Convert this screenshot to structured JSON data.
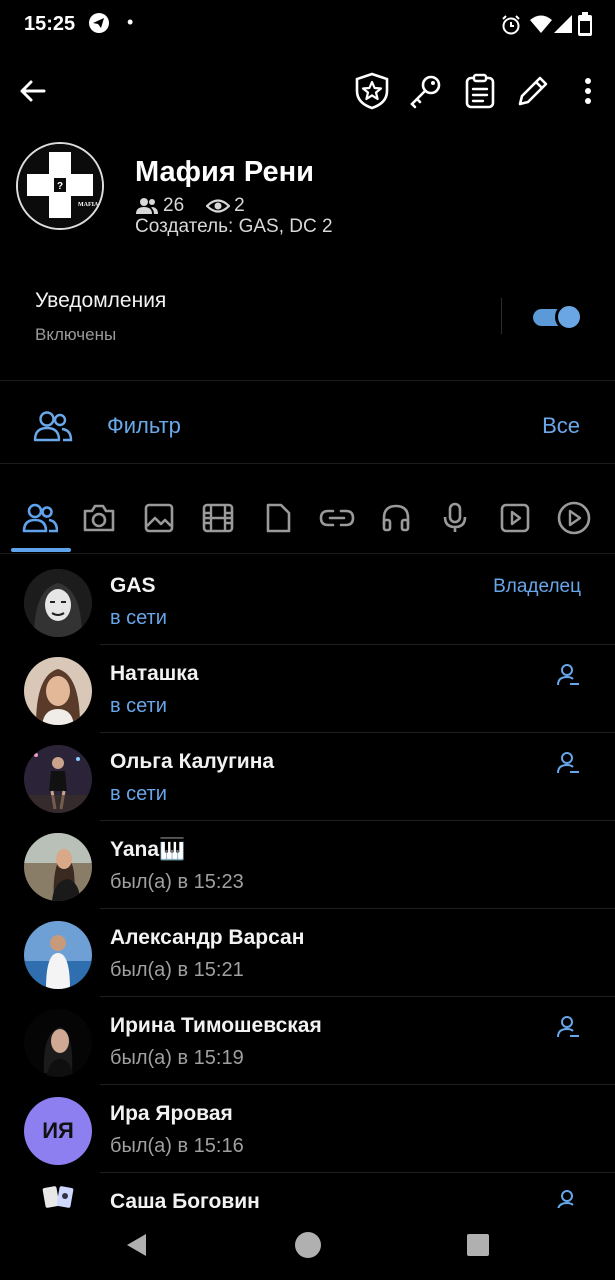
{
  "status_bar": {
    "time": "15:25",
    "dot": "•"
  },
  "header": {
    "title": "Мафия Рени",
    "members_count": "26",
    "online_count": "2",
    "creator": "Создатель: GAS, DC 2",
    "logo_text": "MAFIA"
  },
  "notifications": {
    "title": "Уведомления",
    "subtitle": "Включены",
    "enabled": true
  },
  "filter": {
    "label": "Фильтр",
    "value": "Все"
  },
  "tabs": [
    "members",
    "photos",
    "images",
    "videos",
    "files",
    "links",
    "music",
    "voice",
    "video-messages",
    "gifs"
  ],
  "members": [
    {
      "name": "GAS",
      "status": "в сети",
      "online": true,
      "role": "Владелец",
      "avatar_initials": "",
      "avatar_color": "#2a2a2a"
    },
    {
      "name": "Наташка",
      "status": "в сети",
      "online": true,
      "admin": true,
      "avatar_initials": "",
      "avatar_color": "#b58a6a"
    },
    {
      "name": "Ольга Калугина",
      "status": "в сети",
      "online": true,
      "admin": true,
      "avatar_initials": "",
      "avatar_color": "#3a3350"
    },
    {
      "name": "Yana🎹",
      "status": "был(а) в 15:23",
      "online": false,
      "avatar_initials": "",
      "avatar_color": "#7a6a58"
    },
    {
      "name": "Александр Варсан",
      "status": "был(а) в 15:21",
      "online": false,
      "avatar_initials": "",
      "avatar_color": "#5c8fc2"
    },
    {
      "name": "Ирина Тимошевская",
      "status": "был(а) в 15:19",
      "online": false,
      "admin": true,
      "avatar_initials": "",
      "avatar_color": "#151515"
    },
    {
      "name": "Ира Яровая",
      "status": "был(а) в 15:16",
      "online": false,
      "avatar_initials": "ИЯ",
      "avatar_color": "#8e7ff0"
    },
    {
      "name": "Саша Боговин",
      "status": "",
      "online": false,
      "admin": true,
      "avatar_initials": "",
      "avatar_color": "#e0e0e0"
    }
  ],
  "colors": {
    "accent": "#67a6e9",
    "background": "#000000"
  }
}
